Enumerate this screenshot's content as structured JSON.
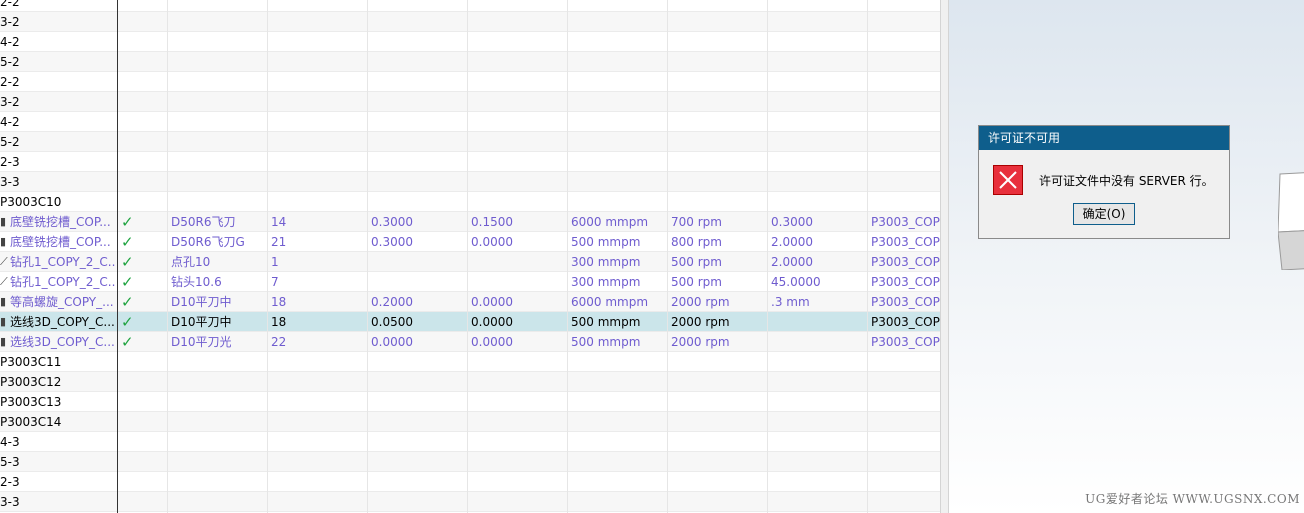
{
  "op_navigator": {
    "rows": [
      {
        "name": "2-2",
        "indent": "small"
      },
      {
        "name": "3-2"
      },
      {
        "name": "4-2"
      },
      {
        "name": "5-2"
      },
      {
        "name": "2-2"
      },
      {
        "name": "3-2"
      },
      {
        "name": "4-2"
      },
      {
        "name": "5-2"
      },
      {
        "name": "2-3"
      },
      {
        "name": "3-3"
      },
      {
        "name": "P3003C10"
      },
      {
        "icon": "mill-icon",
        "name": "底壁铣挖槽_COP...",
        "status": "ok",
        "tool": "D50R6飞刀",
        "toolno": "14",
        "c1": "0.3000",
        "c2": "0.1500",
        "feed": "6000 mmpm",
        "speed": "700 rpm",
        "c3": "0.3000",
        "prog": "P3003_COP'",
        "style": "purple"
      },
      {
        "icon": "mill-icon",
        "name": "底壁铣挖槽_COP...",
        "status": "ok",
        "tool": "D50R6飞刀G",
        "toolno": "21",
        "c1": "0.3000",
        "c2": "0.0000",
        "feed": "500 mmpm",
        "speed": "800 rpm",
        "c3": "2.0000",
        "prog": "P3003_COP'",
        "style": "purple"
      },
      {
        "icon": "drill-icon",
        "name": "钻孔1_COPY_2_C...",
        "status": "ok",
        "tool": "点孔10",
        "toolno": "1",
        "c1": "",
        "c2": "",
        "feed": "300 mmpm",
        "speed": "500 rpm",
        "c3": "2.0000",
        "prog": "P3003_COP'",
        "style": "purple"
      },
      {
        "icon": "drill-icon",
        "name": "钻孔1_COPY_2_C...",
        "status": "ok",
        "tool": "钻头10.6",
        "toolno": "7",
        "c1": "",
        "c2": "",
        "feed": "300 mmpm",
        "speed": "500 rpm",
        "c3": "45.0000",
        "prog": "P3003_COP'",
        "style": "purple"
      },
      {
        "icon": "mill-icon",
        "name": "等高螺旋_COPY_...",
        "status": "ok",
        "tool": "D10平刀中",
        "toolno": "18",
        "c1": "0.2000",
        "c2": "0.0000",
        "feed": "6000 mmpm",
        "speed": "2000 rpm",
        "c3": ".3 mm",
        "prog": "P3003_COP'",
        "style": "purple"
      },
      {
        "icon": "mill-icon",
        "name": "选线3D_COPY_C...",
        "status": "ok",
        "tool": "D10平刀中",
        "toolno": "18",
        "c1": "0.0500",
        "c2": "0.0000",
        "feed": "500 mmpm",
        "speed": "2000 rpm",
        "c3": "",
        "prog": "P3003_COP'",
        "style": "selected"
      },
      {
        "icon": "mill-icon",
        "name": "选线3D_COPY_C...",
        "status": "ok",
        "tool": "D10平刀光",
        "toolno": "22",
        "c1": "0.0000",
        "c2": "0.0000",
        "feed": "500 mmpm",
        "speed": "2000 rpm",
        "c3": "",
        "prog": "P3003_COP'",
        "style": "purple"
      },
      {
        "name": "P3003C11"
      },
      {
        "name": "P3003C12"
      },
      {
        "name": "P3003C13"
      },
      {
        "name": "P3003C14"
      },
      {
        "name": "4-3"
      },
      {
        "name": "5-3"
      },
      {
        "name": "2-3"
      },
      {
        "name": "3-3"
      }
    ]
  },
  "dialog": {
    "title": "许可证不可用",
    "icon": "error-x-icon",
    "message": "许可证文件中没有 SERVER 行。",
    "ok_label": "确定(O)"
  },
  "watermark": "UG爱好者论坛 WWW.UGSNX.COM",
  "colors": {
    "accent": "#0e5e8c",
    "selected_row": "#cbe5ea",
    "op_text": "#6f5ccf",
    "check": "#1fa340",
    "error": "#e8303c"
  }
}
